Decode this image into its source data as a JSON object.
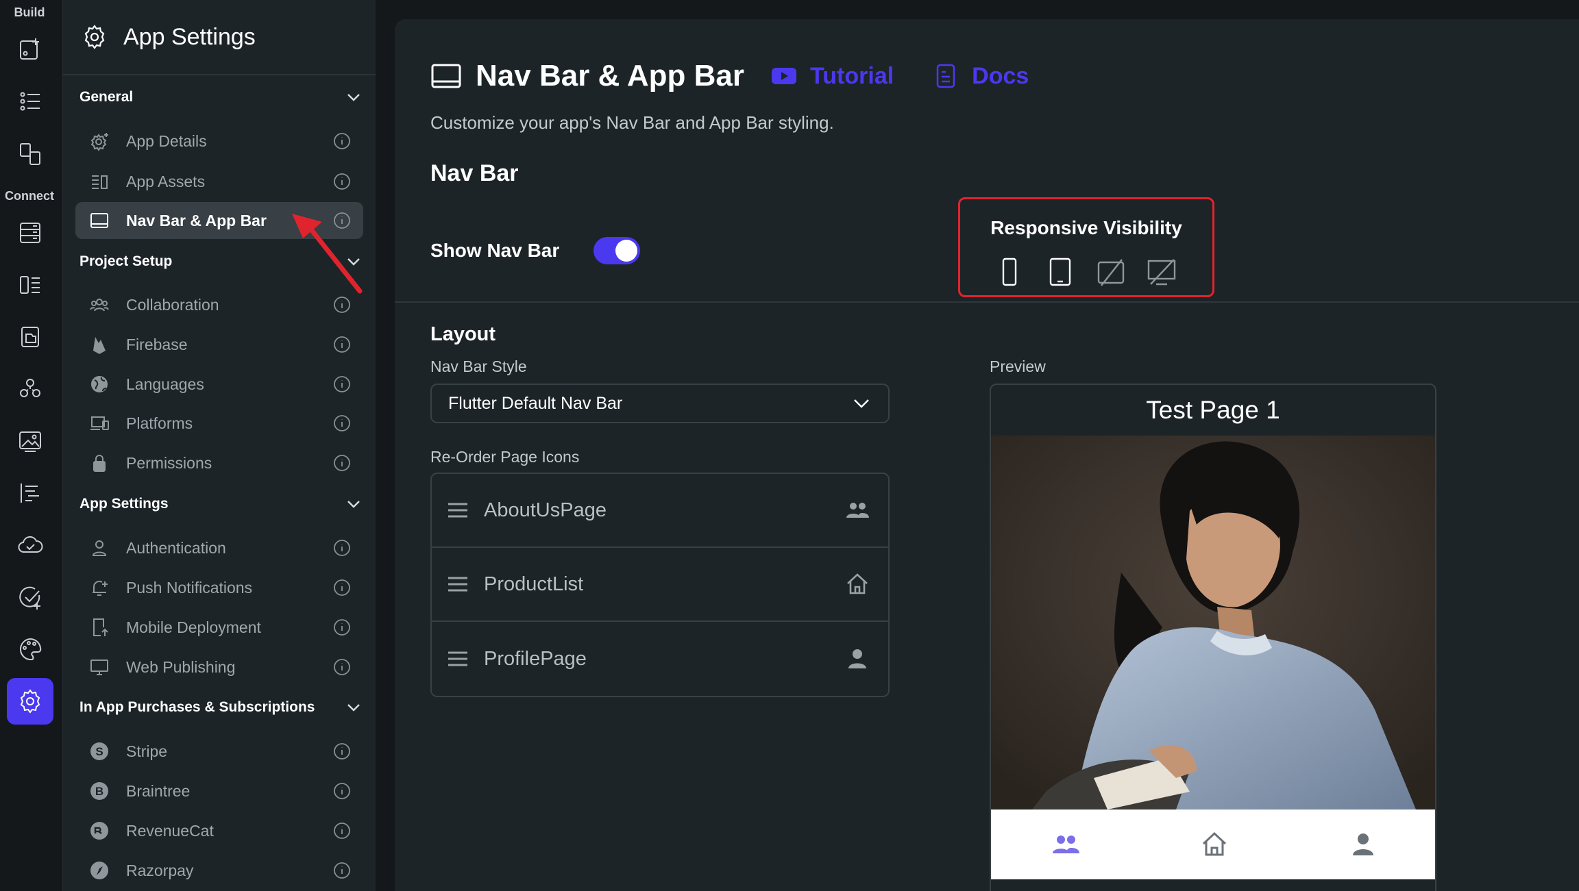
{
  "rail": {
    "build_label": "Build",
    "connect_label": "Connect"
  },
  "sidebar": {
    "title": "App Settings",
    "sections": [
      {
        "label": "General",
        "items": [
          {
            "label": "App Details",
            "icon": "gear-sparkle-icon"
          },
          {
            "label": "App Assets",
            "icon": "assets-icon"
          },
          {
            "label": "Nav Bar & App Bar",
            "icon": "navbar-icon",
            "active": true
          }
        ]
      },
      {
        "label": "Project Setup",
        "items": [
          {
            "label": "Collaboration",
            "icon": "people-icon"
          },
          {
            "label": "Firebase",
            "icon": "firebase-icon"
          },
          {
            "label": "Languages",
            "icon": "globe-icon"
          },
          {
            "label": "Platforms",
            "icon": "devices-icon"
          },
          {
            "label": "Permissions",
            "icon": "lock-icon"
          }
        ]
      },
      {
        "label": "App Settings",
        "items": [
          {
            "label": "Authentication",
            "icon": "person-icon"
          },
          {
            "label": "Push Notifications",
            "icon": "bell-icon"
          },
          {
            "label": "Mobile Deployment",
            "icon": "mobile-deploy-icon"
          },
          {
            "label": "Web Publishing",
            "icon": "monitor-icon"
          }
        ]
      },
      {
        "label": "In App Purchases & Subscriptions",
        "items": [
          {
            "label": "Stripe",
            "icon": "stripe-icon"
          },
          {
            "label": "Braintree",
            "icon": "braintree-icon"
          },
          {
            "label": "RevenueCat",
            "icon": "revenuecat-icon"
          },
          {
            "label": "Razorpay",
            "icon": "razorpay-icon"
          }
        ]
      }
    ]
  },
  "main": {
    "title": "Nav Bar & App Bar",
    "tutorial_label": "Tutorial",
    "docs_label": "Docs",
    "subtitle": "Customize your app's Nav Bar and App Bar styling.",
    "navbar_heading": "Nav Bar",
    "show_nav_bar_label": "Show Nav Bar",
    "show_nav_bar_on": true,
    "responsive_visibility_title": "Responsive Visibility",
    "layout_heading": "Layout",
    "nav_bar_style_label": "Nav Bar Style",
    "nav_bar_style_value": "Flutter Default Nav Bar",
    "reorder_label": "Re-Order Page Icons",
    "pages": [
      {
        "name": "AboutUsPage",
        "icon": "group-icon"
      },
      {
        "name": "ProductList",
        "icon": "home-icon"
      },
      {
        "name": "ProfilePage",
        "icon": "person-icon"
      }
    ],
    "preview_label": "Preview",
    "preview_page_title": "Test Page 1"
  },
  "colors": {
    "accent": "#4b39ef",
    "highlight_border": "#e0242e",
    "background": "#14181b",
    "panel": "#1d2428"
  }
}
